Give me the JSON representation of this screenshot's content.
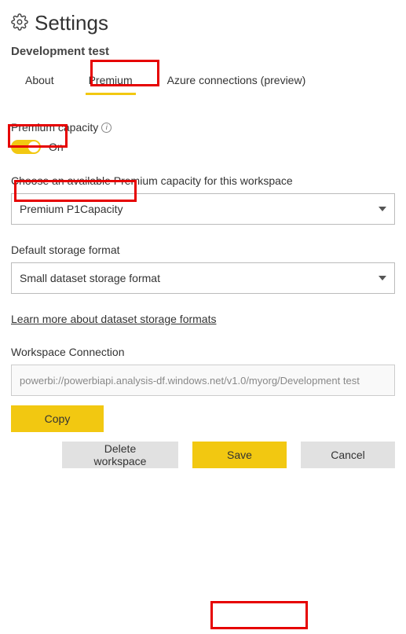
{
  "header": {
    "title": "Settings"
  },
  "workspace_name": "Development test",
  "tabs": {
    "about": "About",
    "premium": "Premium",
    "azure": "Azure connections (preview)"
  },
  "premium_capacity": {
    "label": "Premium capacity",
    "toggle_state": "On"
  },
  "capacity_select": {
    "label": "Choose an available Premium capacity for this workspace",
    "value": "Premium P1Capacity"
  },
  "storage_format": {
    "label": "Default storage format",
    "value": "Small dataset storage format",
    "learn_more": "Learn more about dataset storage formats"
  },
  "workspace_connection": {
    "label": "Workspace Connection",
    "value": "powerbi://powerbiapi.analysis-df.windows.net/v1.0/myorg/Development test"
  },
  "buttons": {
    "copy": "Copy",
    "delete": "Delete workspace",
    "save": "Save",
    "cancel": "Cancel"
  }
}
